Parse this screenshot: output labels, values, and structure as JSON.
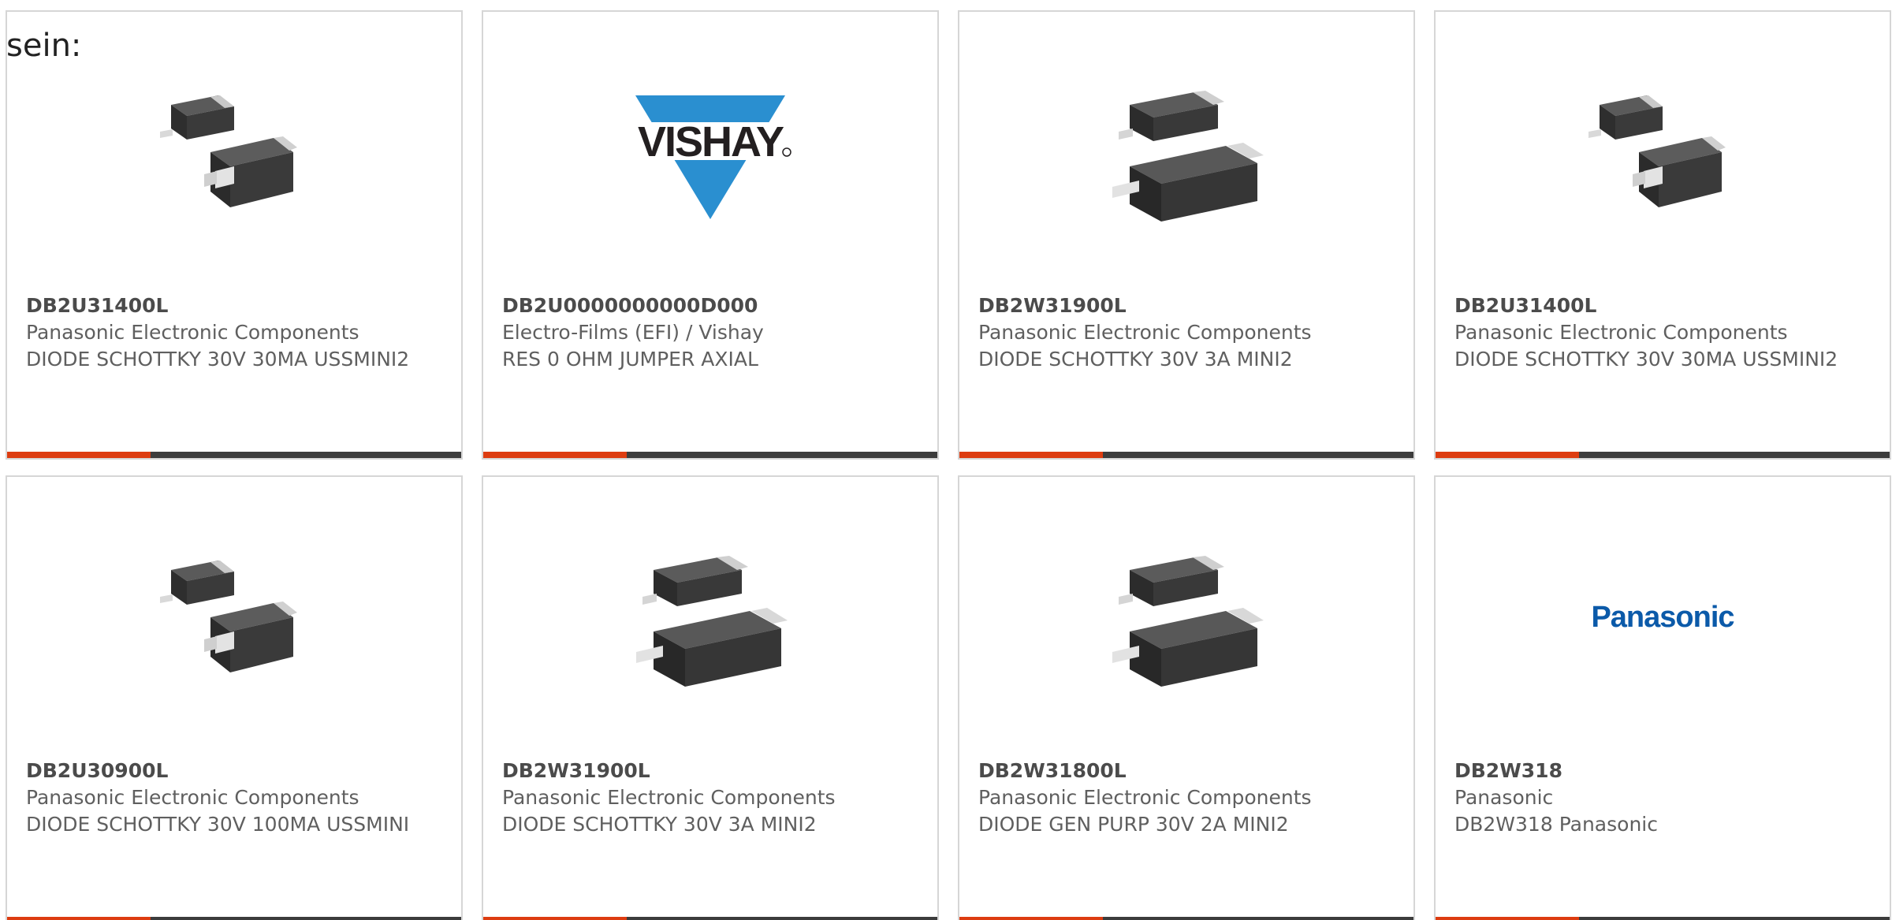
{
  "page": {
    "intro": "sein:"
  },
  "colors": {
    "accent": "#dd3c10",
    "bar": "#3c3c3c",
    "vishay_blue": "#2a8fd0",
    "panasonic_blue": "#0b5aa9"
  },
  "products": [
    {
      "part": "DB2U31400L",
      "manufacturer": "Panasonic Electronic Components",
      "description": "DIODE SCHOTTKY 30V 30MA USSMINI2",
      "image": "ussmini-package"
    },
    {
      "part": "DB2U0000000000D000",
      "manufacturer": "Electro-Films (EFI) / Vishay",
      "description": "RES 0 OHM JUMPER AXIAL",
      "image": "vishay-logo",
      "logo_text": "VISHAY"
    },
    {
      "part": "DB2W31900L",
      "manufacturer": "Panasonic Electronic Components",
      "description": "DIODE SCHOTTKY 30V 3A MINI2",
      "image": "mini2-package"
    },
    {
      "part": "DB2U31400L",
      "manufacturer": "Panasonic Electronic Components",
      "description": "DIODE SCHOTTKY 30V 30MA USSMINI2",
      "image": "ussmini-package"
    },
    {
      "part": "DB2U30900L",
      "manufacturer": "Panasonic Electronic Components",
      "description": "DIODE SCHOTTKY 30V 100MA USSMINI",
      "image": "ussmini-package"
    },
    {
      "part": "DB2W31900L",
      "manufacturer": "Panasonic Electronic Components",
      "description": "DIODE SCHOTTKY 30V 3A MINI2",
      "image": "mini2-package"
    },
    {
      "part": "DB2W31800L",
      "manufacturer": "Panasonic Electronic Components",
      "description": "DIODE GEN PURP 30V 2A MINI2",
      "image": "mini2-package"
    },
    {
      "part": "DB2W318",
      "manufacturer": "Panasonic",
      "description": "DB2W318 Panasonic",
      "image": "panasonic-logo",
      "logo_text": "Panasonic"
    }
  ]
}
